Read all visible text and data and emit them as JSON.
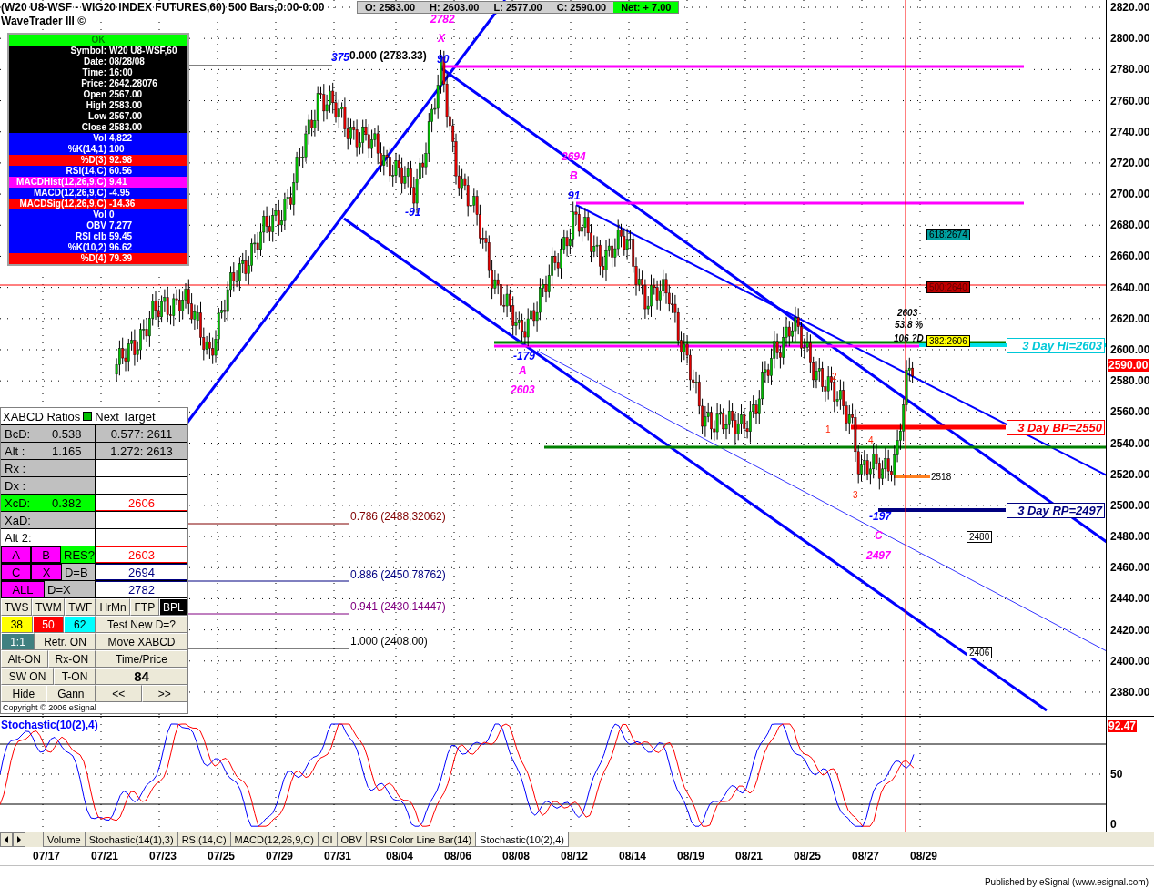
{
  "header": {
    "title": "(W20 U8-WSF - WIG20 INDEX FUTURES,60) 500 Bars,0:00-0:00",
    "subtitle": "WaveTrader III ©",
    "quote": [
      {
        "text": "O: 2583.00",
        "kind": "plain"
      },
      {
        "text": "H: 2603.00",
        "kind": "plain"
      },
      {
        "text": "L: 2577.00",
        "kind": "plain"
      },
      {
        "text": "C: 2590.00",
        "kind": "plain"
      },
      {
        "text": "Net: + 7.00",
        "kind": "net"
      }
    ]
  },
  "info_panel": {
    "status": "OK",
    "rows": [
      {
        "label": "Symbol:",
        "value": "W20 U8-WSF,60",
        "color": "#000000"
      },
      {
        "label": "Date:",
        "value": "08/28/08",
        "color": "#000000"
      },
      {
        "label": "Time:",
        "value": "16:00",
        "color": "#000000"
      },
      {
        "label": "Price:",
        "value": "2642.28076",
        "color": "#000000"
      },
      {
        "label": "Open",
        "value": "2567.00",
        "color": "#000000"
      },
      {
        "label": "High",
        "value": "2583.00",
        "color": "#000000"
      },
      {
        "label": "Low",
        "value": "2567.00",
        "color": "#000000"
      },
      {
        "label": "Close",
        "value": "2583.00",
        "color": "#000000"
      },
      {
        "label": "Vol",
        "value": "4,822",
        "color": "#0000ff"
      },
      {
        "label": "%K(14,1)",
        "value": "100",
        "color": "#0000ff"
      },
      {
        "label": "%D(3)",
        "value": "92.98",
        "color": "#ff0000"
      },
      {
        "label": "RSI(14,C)",
        "value": "60.56",
        "color": "#0000ff"
      },
      {
        "label": "MACDHist(12,26,9,C)",
        "value": "9.41",
        "color": "#ff00ff"
      },
      {
        "label": "MACD(12,26,9,C)",
        "value": "-4.95",
        "color": "#0000ff"
      },
      {
        "label": "MACDSig(12,26,9,C)",
        "value": "-14.36",
        "color": "#ff0000"
      },
      {
        "label": "Vol",
        "value": "0",
        "color": "#0000ff"
      },
      {
        "label": "OBV",
        "value": "7,277",
        "color": "#0000ff"
      },
      {
        "label": "RSI clb",
        "value": "59.45",
        "color": "#0000ff"
      },
      {
        "label": "%K(10,2)",
        "value": "96.62",
        "color": "#0000ff"
      },
      {
        "label": "%D(4)",
        "value": "79.39",
        "color": "#ff0000"
      }
    ]
  },
  "price_chart": {
    "price_axis": [
      "2820.00",
      "2800.00",
      "2780.00",
      "2760.00",
      "2740.00",
      "2720.00",
      "2700.00",
      "2680.00",
      "2660.00",
      "2640.00",
      "2620.00",
      "2600.00",
      "2580.00",
      "2560.00",
      "2540.00",
      "2520.00",
      "2500.00",
      "2480.00",
      "2460.00",
      "2440.00",
      "2420.00",
      "2400.00",
      "2380.00"
    ],
    "last_price": "2590.00",
    "annotations": [
      {
        "text": "2782",
        "kind": "pattern"
      },
      {
        "text": "X",
        "kind": "pattern"
      },
      {
        "text": "375",
        "kind": "count"
      },
      {
        "text": "0.000 (2783.33)",
        "kind": "plain"
      },
      {
        "text": "90",
        "kind": "count"
      },
      {
        "text": "-91",
        "kind": "count"
      },
      {
        "text": "2694",
        "kind": "pattern"
      },
      {
        "text": "B",
        "kind": "pattern"
      },
      {
        "text": "91",
        "kind": "count"
      },
      {
        "text": "-179",
        "kind": "count"
      },
      {
        "text": "A",
        "kind": "pattern"
      },
      {
        "text": "2603",
        "kind": "pattern"
      },
      {
        "text": "2603",
        "kind": "note"
      },
      {
        "text": "53.8 %",
        "kind": "note"
      },
      {
        "text": "106 ?D",
        "kind": "note"
      },
      {
        "text": "1",
        "kind": "wave"
      },
      {
        "text": "2",
        "kind": "wave"
      },
      {
        "text": "3",
        "kind": "wave"
      },
      {
        "text": "4",
        "kind": "wave"
      },
      {
        "text": "2518",
        "kind": "tag"
      },
      {
        "text": "-197",
        "kind": "count"
      },
      {
        "text": "C",
        "kind": "pattern"
      },
      {
        "text": "2497",
        "kind": "pattern"
      },
      {
        "text": "0.786 (2488,32062)",
        "kind": "fib",
        "color": "#800000"
      },
      {
        "text": "0.886 (2450.78762)",
        "kind": "fib",
        "color": "#000080"
      },
      {
        "text": "0.941 (2430.14447)",
        "kind": "fib",
        "color": "#800080"
      },
      {
        "text": "1.000 (2408.00)",
        "kind": "fib",
        "color": "#000000"
      }
    ],
    "level_tags": [
      {
        "text": "618:2674",
        "color": "#00a0a0"
      },
      {
        "text": "500:2640",
        "color": "#c00000"
      },
      {
        "text": "382:2606",
        "color": "#ffff00"
      },
      {
        "text": "2480",
        "color": "#ffffff"
      },
      {
        "text": "2406",
        "color": "#ffffff"
      }
    ],
    "day_levels": [
      {
        "text": "3 Day HI=2603",
        "color": "#00c8d8"
      },
      {
        "text": "3 Day BP=2550",
        "color": "#ff0000"
      },
      {
        "text": "3 Day RP=2497",
        "color": "#000080"
      }
    ]
  },
  "xabcd": {
    "title": "XABCD Ratios",
    "next_target": "Next Target",
    "ratios": [
      {
        "label": "BcD:",
        "value": "0.538",
        "target": "0.577: 2611",
        "color": "#c0c0c0"
      },
      {
        "label": "Alt :",
        "value": "1.165",
        "target": "1.272: 2613",
        "color": "#c0c0c0"
      },
      {
        "label": "Rx :",
        "color": "#c0c0c0"
      },
      {
        "label": "Dx :",
        "color": "#c0c0c0"
      },
      {
        "label": "XcD:",
        "value": "0.382",
        "target": "2606",
        "color": "#00ff00",
        "kind": "alert"
      },
      {
        "label": "XaD:",
        "color": "#c0c0c0"
      },
      {
        "label": "Alt 2:",
        "color": "#ffffff"
      }
    ],
    "pickers": [
      {
        "keys": [
          "A",
          "B"
        ],
        "label": "RES?",
        "color": "#00ff00",
        "target": "2603",
        "kind": "alert"
      },
      {
        "keys": [
          "C",
          "X"
        ],
        "label": "D=B",
        "color": "#c0c0c0",
        "target": "2694",
        "kind": "level"
      },
      {
        "keys": [
          "ALL"
        ],
        "label": "D=X",
        "color": "#c0c0c0",
        "target": "2782",
        "kind": "level"
      }
    ],
    "buttons": [
      {
        "left": [
          {
            "label": "TWS"
          },
          {
            "label": "TWM"
          },
          {
            "label": "TWF"
          }
        ],
        "right": [
          {
            "label": "HrMn"
          },
          {
            "label": "FTP"
          },
          {
            "label": "BPL",
            "color": "#000000"
          }
        ]
      },
      {
        "left": [
          {
            "label": "38",
            "color": "#ffff00"
          },
          {
            "label": "50",
            "color": "#ff0000"
          },
          {
            "label": "62",
            "color": "#00ffff"
          }
        ],
        "right": [
          {
            "label": "Test New D=?"
          }
        ]
      },
      {
        "left": [
          {
            "label": "1:1",
            "color": "#408080"
          },
          {
            "label": "Retr. ON"
          }
        ],
        "right": [
          {
            "label": "Move XABCD"
          }
        ]
      },
      {
        "left": [
          {
            "label": "Alt-ON"
          },
          {
            "label": "Rx-ON"
          }
        ],
        "right": [
          {
            "label": "Time/Price"
          }
        ]
      },
      {
        "left": [
          {
            "label": "SW ON"
          },
          {
            "label": "T-ON"
          }
        ],
        "right": [
          {
            "label": "84"
          }
        ]
      },
      {
        "left": [
          {
            "label": "Hide"
          },
          {
            "label": "Gann"
          }
        ],
        "right": [
          {
            "label": "<<"
          },
          {
            "label": ">>"
          }
        ]
      }
    ],
    "copyright": "Copyright © 2006 eSignal"
  },
  "stochastic": {
    "title": "Stochastic(10(2),4)",
    "reading": "92.47",
    "axis": [
      "50",
      "0"
    ]
  },
  "tabs": [
    {
      "label": "Volume",
      "selected": false
    },
    {
      "label": "Stochastic(14(1),3)",
      "selected": false
    },
    {
      "label": "RSI(14,C)",
      "selected": false
    },
    {
      "label": "MACD(12,26,9,C)",
      "selected": false
    },
    {
      "label": "OI",
      "selected": false
    },
    {
      "label": "OBV",
      "selected": false
    },
    {
      "label": "RSI Color Line Bar(14)",
      "selected": false
    },
    {
      "label": "Stochastic(10(2),4)",
      "selected": true
    }
  ],
  "dates": [
    "07/17",
    "07/21",
    "07/23",
    "07/25",
    "07/29",
    "07/31",
    "08/04",
    "08/06",
    "08/08",
    "08/12",
    "08/14",
    "08/19",
    "08/21",
    "08/25",
    "08/27",
    "08/29"
  ],
  "footer": "Published by eSignal (www.esignal.com)"
}
